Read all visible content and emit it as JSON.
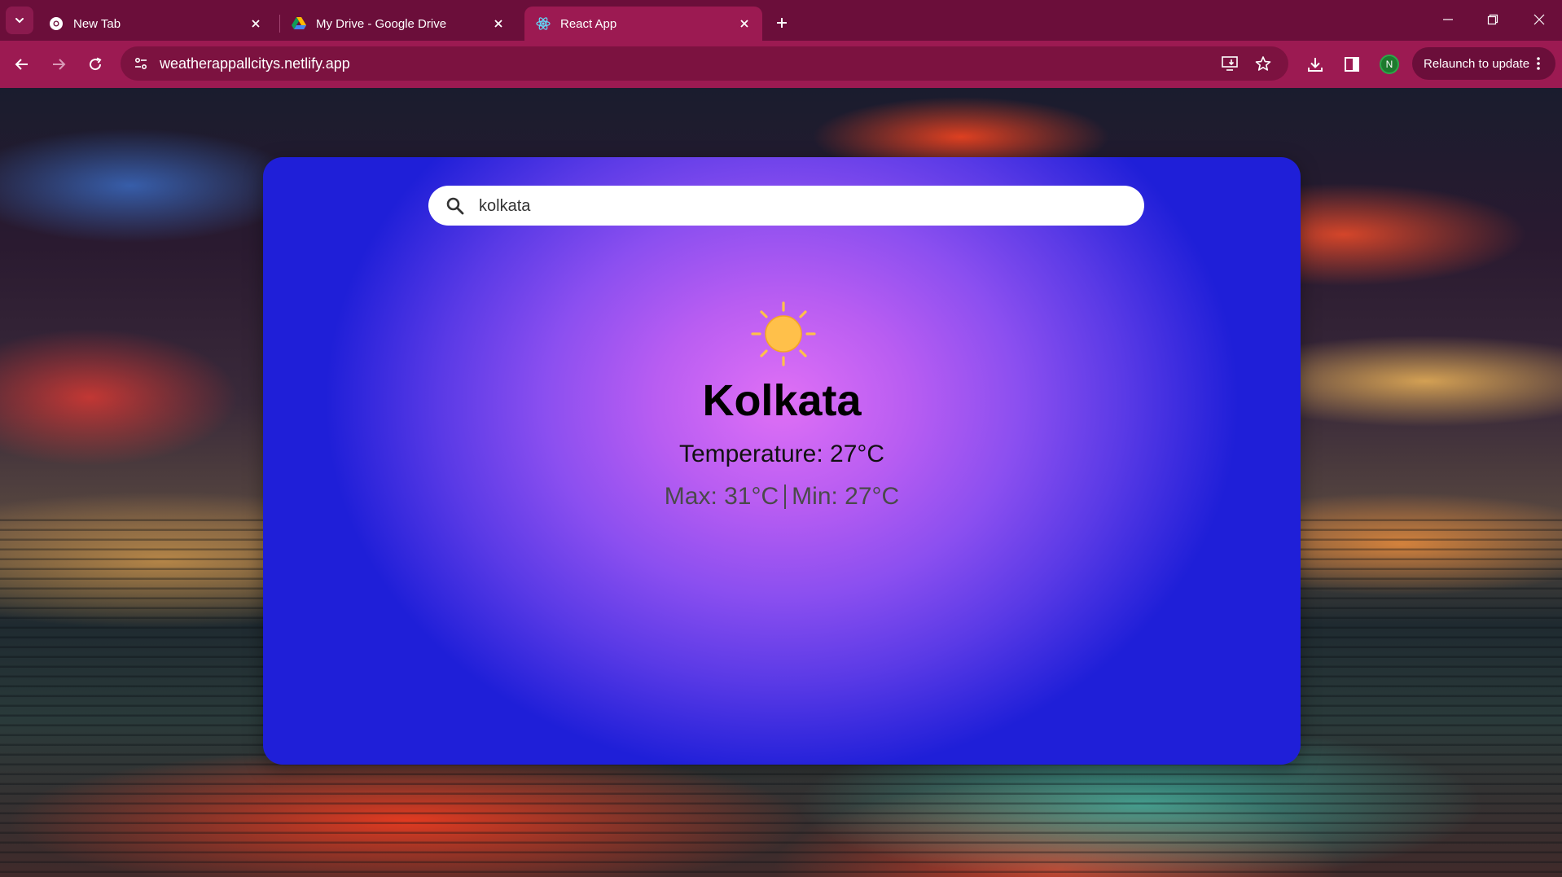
{
  "browser": {
    "tabs": [
      {
        "label": "New Tab",
        "icon": "chrome-icon",
        "active": false
      },
      {
        "label": "My Drive - Google Drive",
        "icon": "google-drive-icon",
        "active": false
      },
      {
        "label": "React App",
        "icon": "react-icon",
        "active": true
      }
    ],
    "address": {
      "url": "weatherappallcitys.netlify.app"
    },
    "profile_initial": "N",
    "relaunch_label": "Relaunch to update",
    "colors": {
      "tabstrip": "#6b0e3a",
      "toolbar": "#9c1a52",
      "omnibox": "#7c1240"
    }
  },
  "app": {
    "search": {
      "value": "kolkata",
      "placeholder": ""
    },
    "weather": {
      "icon": "sun-icon",
      "city": "Kolkata",
      "temperature_text": "Temperature: 27°C",
      "max_text": "Max: 31°C",
      "min_text": "Min: 27°C"
    },
    "colors": {
      "card_center": "#e070f5",
      "card_edge": "#1f1fd8",
      "sun": "#ffc04a"
    }
  }
}
